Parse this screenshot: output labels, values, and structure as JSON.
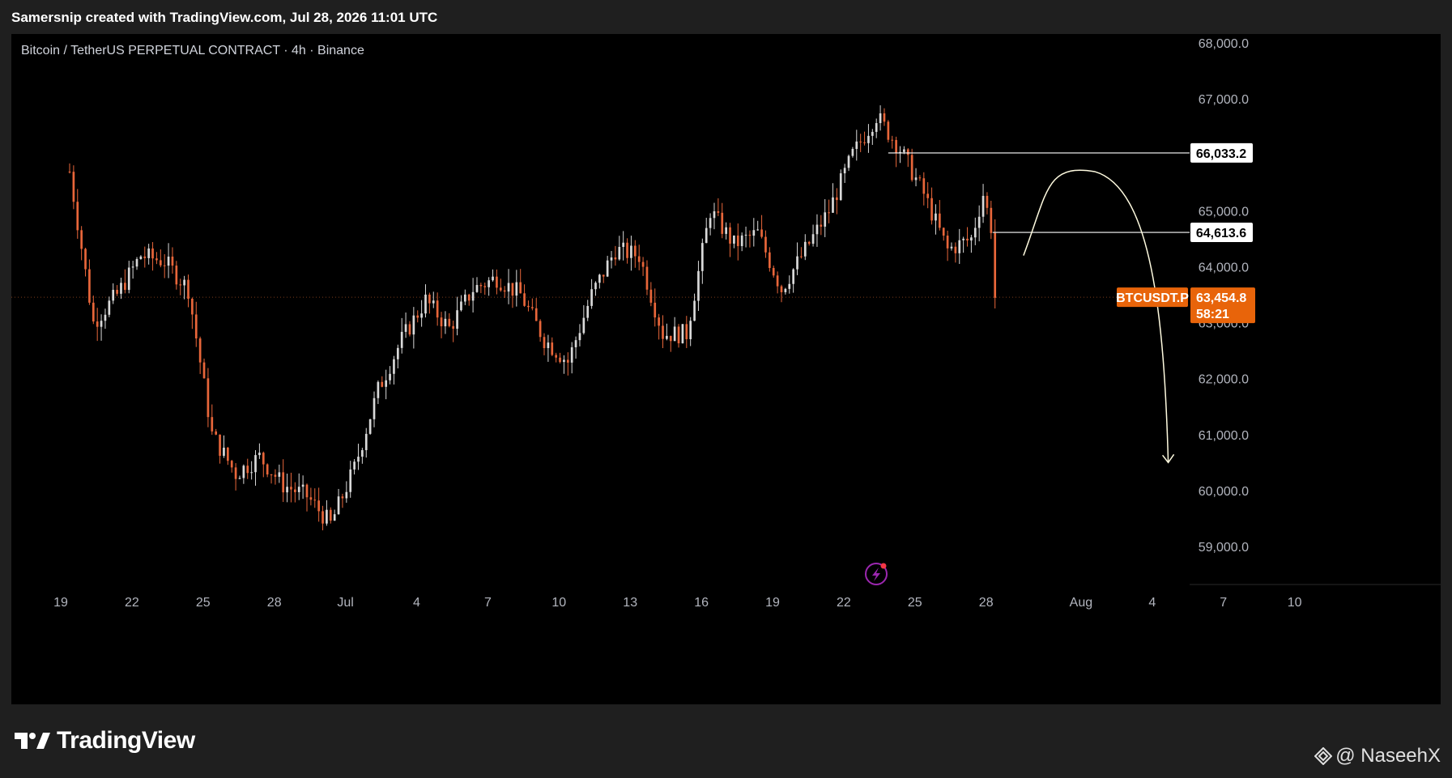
{
  "header": {
    "title": "Samersnip created with TradingView.com, Jul 28, 2026 11:01 UTC"
  },
  "symbol_line": "Bitcoin / TetherUS PERPETUAL CONTRACT · 4h · Binance",
  "footer": {
    "logo_text": "TradingView",
    "logo_icon": "tradingview-logo-icon",
    "watermark_text": "@ NaseehX",
    "watermark_icon": "binance-diamond-icon"
  },
  "colors": {
    "background": "#000000",
    "frame": "#1f1f1f",
    "up_candle": "#d9d9d9",
    "down_candle": "#e8663a",
    "price_tag": "#e8640a",
    "drawing": "#ffffff",
    "projection_curve": "#fffbe0",
    "axis_text": "#b2b5be",
    "flash_icon": "#9c27b0"
  },
  "chart_data": {
    "type": "candlestick",
    "title": "Bitcoin / TetherUS PERPETUAL CONTRACT · 4h · Binance",
    "ylim": [
      58000,
      68200
    ],
    "y_ticks": [
      "68,000.0",
      "67,000.0",
      "65,000.0",
      "64,000.0",
      "62,000.0",
      "61,000.0",
      "60,000.0",
      "59,000.0"
    ],
    "y_tick_values": [
      68000,
      67000,
      65000,
      64000,
      62000,
      61000,
      60000,
      59000
    ],
    "hidden_tick": {
      "label": "63,000.0",
      "value": 63000
    },
    "x_ticks": [
      "19",
      "22",
      "25",
      "28",
      "Jul",
      "4",
      "7",
      "10",
      "13",
      "16",
      "19",
      "22",
      "25",
      "28",
      "Aug",
      "4",
      "7",
      "10"
    ],
    "x_tick_days": [
      0,
      3,
      6,
      9,
      12,
      15,
      18,
      21,
      24,
      27,
      30,
      33,
      36,
      39,
      43,
      46,
      49,
      52
    ],
    "day_axis_note": "days counted from Jun 19",
    "price_series_daily": [
      [
        0,
        65700
      ],
      [
        1,
        63000
      ],
      [
        2,
        63500
      ],
      [
        3,
        64200
      ],
      [
        4,
        64100
      ],
      [
        5,
        63600
      ],
      [
        6,
        61000
      ],
      [
        7,
        60300
      ],
      [
        8,
        60600
      ],
      [
        9,
        60100
      ],
      [
        10,
        59900
      ],
      [
        11,
        59400
      ],
      [
        12,
        60400
      ],
      [
        13,
        61800
      ],
      [
        14,
        62700
      ],
      [
        15,
        63400
      ],
      [
        16,
        62900
      ],
      [
        17,
        63600
      ],
      [
        18,
        63800
      ],
      [
        19,
        63500
      ],
      [
        20,
        62700
      ],
      [
        21,
        62300
      ],
      [
        22,
        63500
      ],
      [
        23,
        64300
      ],
      [
        24,
        64200
      ],
      [
        25,
        62800
      ],
      [
        26,
        62800
      ],
      [
        27,
        65000
      ],
      [
        28,
        64400
      ],
      [
        29,
        64600
      ],
      [
        30,
        63600
      ],
      [
        31,
        64300
      ],
      [
        32,
        65000
      ],
      [
        33,
        66000
      ],
      [
        34,
        66700
      ],
      [
        35,
        66100
      ],
      [
        36,
        65300
      ],
      [
        37,
        64300
      ],
      [
        38,
        64500
      ],
      [
        38.5,
        65300
      ],
      [
        38.9,
        64600
      ],
      [
        39,
        63455
      ]
    ],
    "horizontal_levels": [
      {
        "label": "66,033.2",
        "value": 66033.2,
        "start_day": 34.5
      },
      {
        "label": "64,613.6",
        "value": 64613.6,
        "start_day": 38.9
      }
    ],
    "last_price": {
      "symbol": "BTCUSDT.P",
      "value": 63454.8,
      "label": "63,454.8",
      "countdown": "58:21"
    },
    "projection": {
      "points": [
        [
          40.2,
          64200
        ],
        [
          43.2,
          65700
        ],
        [
          46.3,
          60500
        ]
      ],
      "style": "curved arrow down"
    }
  }
}
